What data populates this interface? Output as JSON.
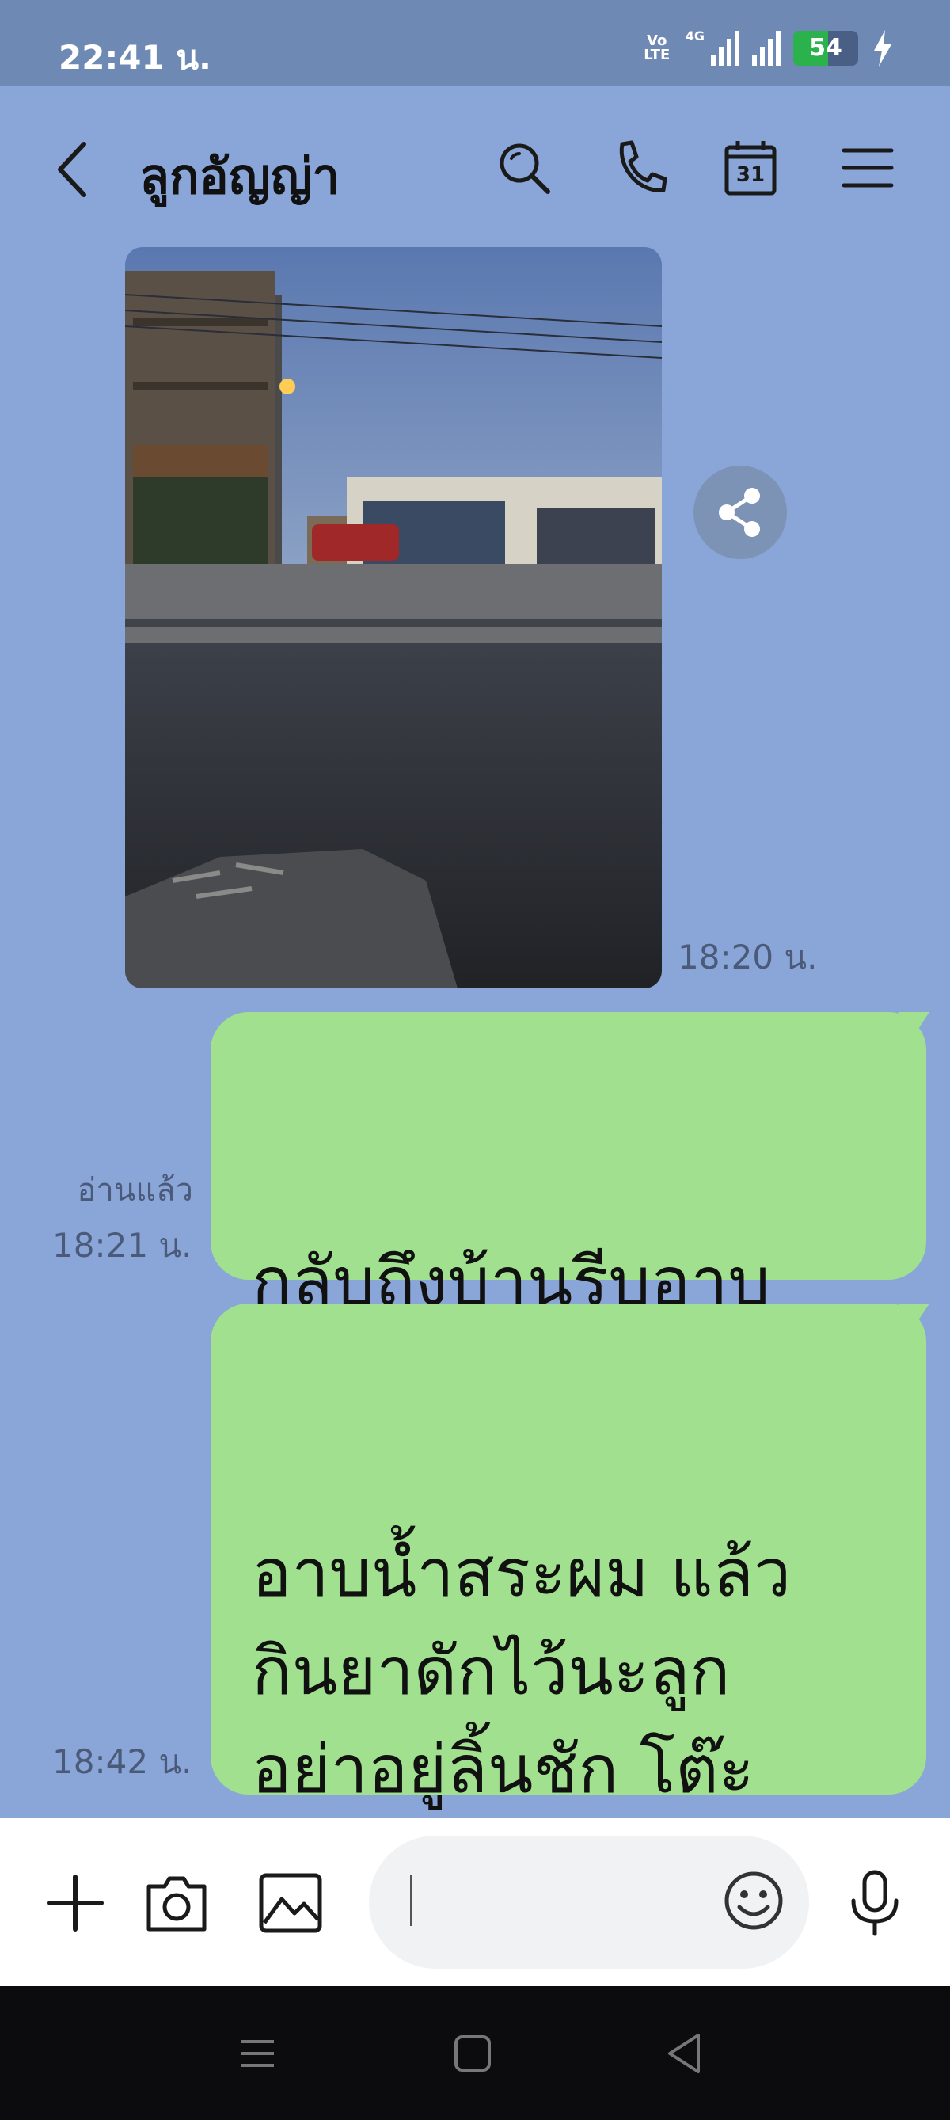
{
  "status_bar": {
    "time": "22:41 น.",
    "volte": "Vo LTE",
    "network": "4G",
    "battery": "54",
    "battery_level": 0.54,
    "battery_color": "#2bb24c"
  },
  "header": {
    "title": "ลูกอัญญ่า",
    "calendar_day": "31",
    "icons": [
      "back-arrow-icon",
      "search-icon",
      "phone-icon",
      "calendar-icon",
      "menu-icon"
    ]
  },
  "messages": [
    {
      "type": "image",
      "time": "18:20 น.",
      "share_icon": "share-icon"
    },
    {
      "type": "text",
      "text": "กลับถึงบ้านรีบอาบ\nน้ำสระผมนะ",
      "read": "อ่านแล้ว",
      "time": "18:21 น."
    },
    {
      "type": "text",
      "text": "อาบน้ำสระผม แล้ว\nกินยาดักไว้นะลูก\nอย่าอยู่ลิ้นชัก โต๊ะ\nกระจกข้างล่างนะ",
      "time": "18:42 น."
    }
  ],
  "input_bar": {
    "icons": [
      "plus-icon",
      "camera-icon",
      "image-icon",
      "emoji-icon",
      "microphone-icon"
    ],
    "message_value": ""
  },
  "colors": {
    "chat_background": "#8aa6d8",
    "bubble": "#a0e08e",
    "status_bar": "#6f89b5",
    "input_bar": "#ffffff",
    "nav_bar": "#0c0c0e"
  }
}
